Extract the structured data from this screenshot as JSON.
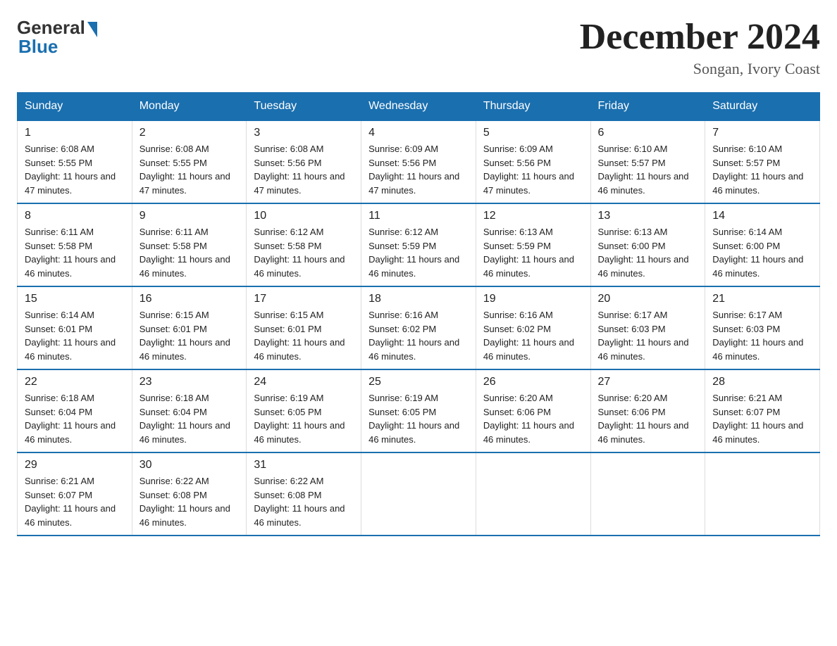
{
  "header": {
    "logo_general": "General",
    "logo_blue": "Blue",
    "title": "December 2024",
    "location": "Songan, Ivory Coast"
  },
  "calendar": {
    "days_of_week": [
      "Sunday",
      "Monday",
      "Tuesday",
      "Wednesday",
      "Thursday",
      "Friday",
      "Saturday"
    ],
    "weeks": [
      [
        {
          "day": "1",
          "sunrise": "6:08 AM",
          "sunset": "5:55 PM",
          "daylight": "11 hours and 47 minutes."
        },
        {
          "day": "2",
          "sunrise": "6:08 AM",
          "sunset": "5:55 PM",
          "daylight": "11 hours and 47 minutes."
        },
        {
          "day": "3",
          "sunrise": "6:08 AM",
          "sunset": "5:56 PM",
          "daylight": "11 hours and 47 minutes."
        },
        {
          "day": "4",
          "sunrise": "6:09 AM",
          "sunset": "5:56 PM",
          "daylight": "11 hours and 47 minutes."
        },
        {
          "day": "5",
          "sunrise": "6:09 AM",
          "sunset": "5:56 PM",
          "daylight": "11 hours and 47 minutes."
        },
        {
          "day": "6",
          "sunrise": "6:10 AM",
          "sunset": "5:57 PM",
          "daylight": "11 hours and 46 minutes."
        },
        {
          "day": "7",
          "sunrise": "6:10 AM",
          "sunset": "5:57 PM",
          "daylight": "11 hours and 46 minutes."
        }
      ],
      [
        {
          "day": "8",
          "sunrise": "6:11 AM",
          "sunset": "5:58 PM",
          "daylight": "11 hours and 46 minutes."
        },
        {
          "day": "9",
          "sunrise": "6:11 AM",
          "sunset": "5:58 PM",
          "daylight": "11 hours and 46 minutes."
        },
        {
          "day": "10",
          "sunrise": "6:12 AM",
          "sunset": "5:58 PM",
          "daylight": "11 hours and 46 minutes."
        },
        {
          "day": "11",
          "sunrise": "6:12 AM",
          "sunset": "5:59 PM",
          "daylight": "11 hours and 46 minutes."
        },
        {
          "day": "12",
          "sunrise": "6:13 AM",
          "sunset": "5:59 PM",
          "daylight": "11 hours and 46 minutes."
        },
        {
          "day": "13",
          "sunrise": "6:13 AM",
          "sunset": "6:00 PM",
          "daylight": "11 hours and 46 minutes."
        },
        {
          "day": "14",
          "sunrise": "6:14 AM",
          "sunset": "6:00 PM",
          "daylight": "11 hours and 46 minutes."
        }
      ],
      [
        {
          "day": "15",
          "sunrise": "6:14 AM",
          "sunset": "6:01 PM",
          "daylight": "11 hours and 46 minutes."
        },
        {
          "day": "16",
          "sunrise": "6:15 AM",
          "sunset": "6:01 PM",
          "daylight": "11 hours and 46 minutes."
        },
        {
          "day": "17",
          "sunrise": "6:15 AM",
          "sunset": "6:01 PM",
          "daylight": "11 hours and 46 minutes."
        },
        {
          "day": "18",
          "sunrise": "6:16 AM",
          "sunset": "6:02 PM",
          "daylight": "11 hours and 46 minutes."
        },
        {
          "day": "19",
          "sunrise": "6:16 AM",
          "sunset": "6:02 PM",
          "daylight": "11 hours and 46 minutes."
        },
        {
          "day": "20",
          "sunrise": "6:17 AM",
          "sunset": "6:03 PM",
          "daylight": "11 hours and 46 minutes."
        },
        {
          "day": "21",
          "sunrise": "6:17 AM",
          "sunset": "6:03 PM",
          "daylight": "11 hours and 46 minutes."
        }
      ],
      [
        {
          "day": "22",
          "sunrise": "6:18 AM",
          "sunset": "6:04 PM",
          "daylight": "11 hours and 46 minutes."
        },
        {
          "day": "23",
          "sunrise": "6:18 AM",
          "sunset": "6:04 PM",
          "daylight": "11 hours and 46 minutes."
        },
        {
          "day": "24",
          "sunrise": "6:19 AM",
          "sunset": "6:05 PM",
          "daylight": "11 hours and 46 minutes."
        },
        {
          "day": "25",
          "sunrise": "6:19 AM",
          "sunset": "6:05 PM",
          "daylight": "11 hours and 46 minutes."
        },
        {
          "day": "26",
          "sunrise": "6:20 AM",
          "sunset": "6:06 PM",
          "daylight": "11 hours and 46 minutes."
        },
        {
          "day": "27",
          "sunrise": "6:20 AM",
          "sunset": "6:06 PM",
          "daylight": "11 hours and 46 minutes."
        },
        {
          "day": "28",
          "sunrise": "6:21 AM",
          "sunset": "6:07 PM",
          "daylight": "11 hours and 46 minutes."
        }
      ],
      [
        {
          "day": "29",
          "sunrise": "6:21 AM",
          "sunset": "6:07 PM",
          "daylight": "11 hours and 46 minutes."
        },
        {
          "day": "30",
          "sunrise": "6:22 AM",
          "sunset": "6:08 PM",
          "daylight": "11 hours and 46 minutes."
        },
        {
          "day": "31",
          "sunrise": "6:22 AM",
          "sunset": "6:08 PM",
          "daylight": "11 hours and 46 minutes."
        },
        null,
        null,
        null,
        null
      ]
    ]
  }
}
